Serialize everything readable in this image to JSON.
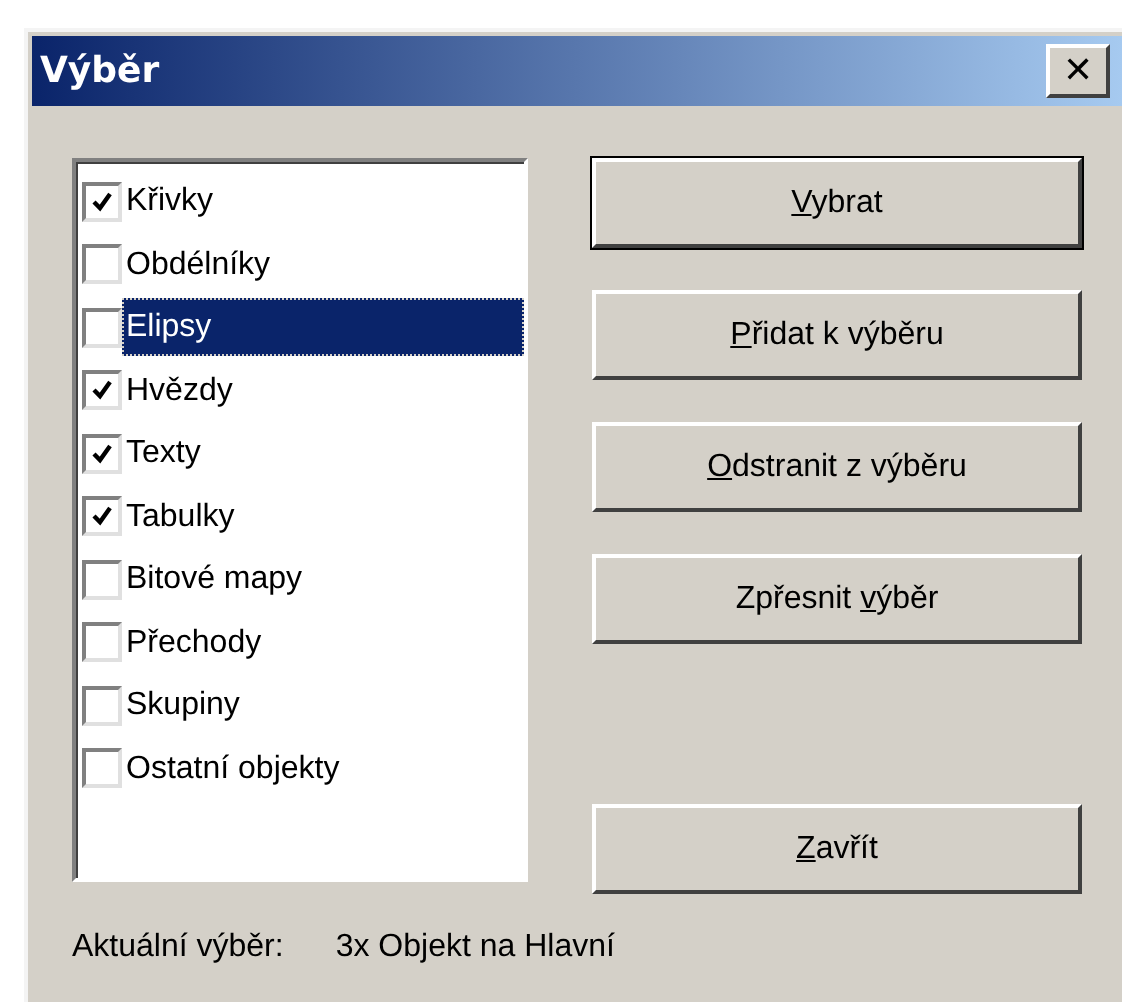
{
  "window": {
    "title": "Výběr",
    "close_glyph": "✕"
  },
  "list": {
    "items": [
      {
        "label": "Křivky",
        "checked": true,
        "selected": false
      },
      {
        "label": "Obdélníky",
        "checked": false,
        "selected": false
      },
      {
        "label": "Elipsy",
        "checked": false,
        "selected": true
      },
      {
        "label": "Hvězdy",
        "checked": true,
        "selected": false
      },
      {
        "label": "Texty",
        "checked": true,
        "selected": false
      },
      {
        "label": "Tabulky",
        "checked": true,
        "selected": false
      },
      {
        "label": "Bitové mapy",
        "checked": false,
        "selected": false
      },
      {
        "label": "Přechody",
        "checked": false,
        "selected": false
      },
      {
        "label": "Skupiny",
        "checked": false,
        "selected": false
      },
      {
        "label": "Ostatní objekty",
        "checked": false,
        "selected": false
      }
    ]
  },
  "buttons": [
    {
      "key": "V",
      "after": "ybrat",
      "default": true
    },
    {
      "key": "P",
      "after": "řidat k výběru",
      "default": false
    },
    {
      "key": "O",
      "after": "dstranit z výběru",
      "default": false
    },
    {
      "before": "Zpřesnit ",
      "key": "v",
      "after": "ýběr",
      "default": false
    }
  ],
  "close_button": {
    "key": "Z",
    "after": "avřít",
    "default": false
  },
  "status": {
    "label": "Aktuální výběr:",
    "value": "3x Objekt na Hlavní"
  }
}
